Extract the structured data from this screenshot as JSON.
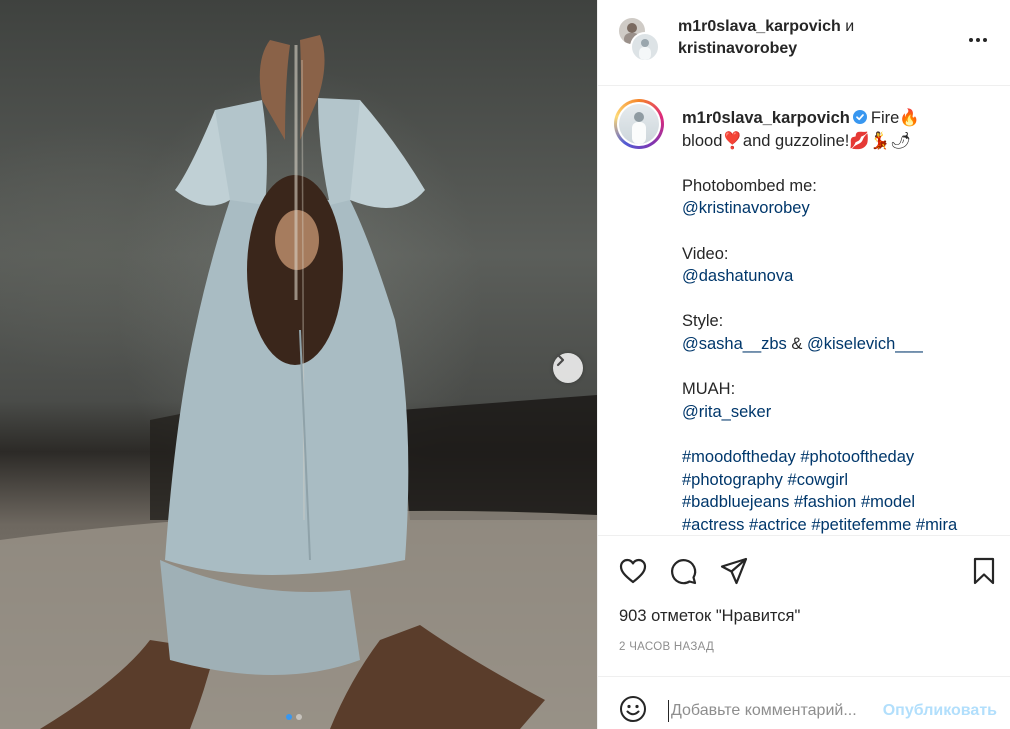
{
  "post": {
    "carousel": {
      "total": 2,
      "active": 1
    }
  },
  "header": {
    "user1": "m1r0slava_karpovich",
    "conjunction": "и",
    "user2": "kristinavorobey"
  },
  "caption": {
    "username": "m1r0slava_karpovich",
    "line1": "Fire🔥",
    "line2": "blood❣️and guzzoline!💋💃🌶",
    "photobombed_label": "Photobombed me:",
    "photobombed_handle": "@kristinavorobey",
    "video_label": "Video:",
    "video_handle": "@dashatunova",
    "style_label": "Style:",
    "style_handle1": "@sasha__zbs",
    "style_amp": " & ",
    "style_handle2": "@kiselevich___",
    "muah_label": "MUAH:",
    "muah_handle": "@rita_seker",
    "tags_line1": [
      "#moodoftheday",
      "#photooftheday"
    ],
    "tags_line2": [
      "#photography",
      "#cowgirl"
    ],
    "tags_line3": [
      "#badbluejeans",
      "#fashion",
      "#model"
    ],
    "tags_line4": [
      "#actress",
      "#actrice",
      "#petitefemme",
      "#mira"
    ]
  },
  "actions": {
    "likes_count": "903",
    "likes_suffix": "отметок \"Нравится\"",
    "timestamp": "2 ЧАСОВ НАЗАД"
  },
  "comment": {
    "placeholder": "Добавьте комментарий...",
    "publish_label": "Опубликовать"
  },
  "icons": {
    "like": "heart-icon",
    "comment": "comment-icon",
    "share": "paper-plane-icon",
    "save": "bookmark-icon",
    "emoji": "smiley-icon",
    "more": "more-dots-icon",
    "next": "chevron-right-icon",
    "verified": "verified-badge-icon"
  },
  "colors": {
    "link": "#00376b",
    "verified": "#3897f0",
    "publish_disabled": "#b2dffc",
    "muted": "#8e8e8e"
  }
}
